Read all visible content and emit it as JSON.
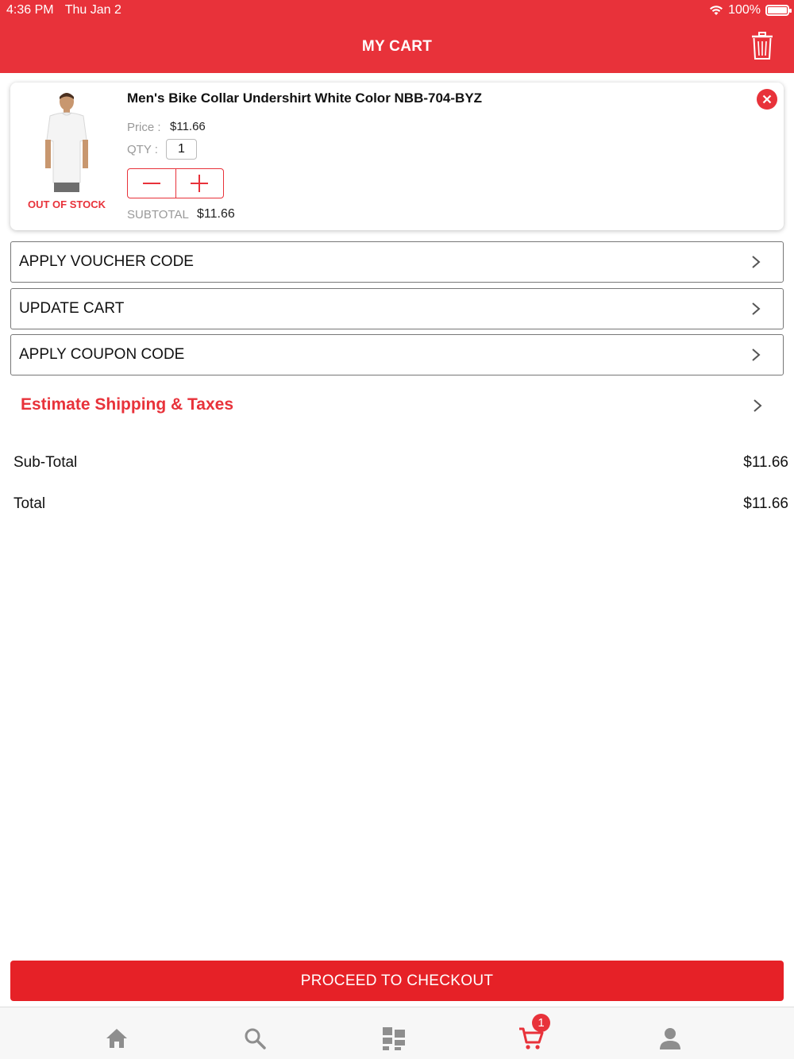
{
  "status_bar": {
    "time": "4:36 PM",
    "date": "Thu Jan 2",
    "battery": "100%"
  },
  "header": {
    "title": "MY CART",
    "trash_icon": "trash-icon"
  },
  "cart_item": {
    "title": "Men's Bike Collar Undershirt White Color NBB-704-BYZ",
    "stock_status": "OUT OF STOCK",
    "price_label": "Price :",
    "price": "$11.66",
    "qty_label": "QTY :",
    "qty": "1",
    "decrement_label": "−",
    "increment_label": "+",
    "subtotal_label": "SUBTOTAL",
    "subtotal": "$11.66"
  },
  "actions": [
    {
      "label": "APPLY VOUCHER CODE"
    },
    {
      "label": "UPDATE CART"
    },
    {
      "label": "APPLY COUPON CODE"
    }
  ],
  "estimate": {
    "label": "Estimate Shipping & Taxes"
  },
  "summary": {
    "subtotal_label": "Sub-Total",
    "subtotal_value": "$11.66",
    "total_label": "Total",
    "total_value": "$11.66"
  },
  "checkout": {
    "label": "PROCEED TO CHECKOUT"
  },
  "tabbar": {
    "items": [
      "home-icon",
      "search-icon",
      "categories-icon",
      "cart-icon",
      "account-icon"
    ],
    "cart_badge": "1",
    "active_color": "#e8323a",
    "inactive_color": "#8e8e8e"
  },
  "colors": {
    "brand": "#e8323a",
    "checkout": "#e62127"
  }
}
